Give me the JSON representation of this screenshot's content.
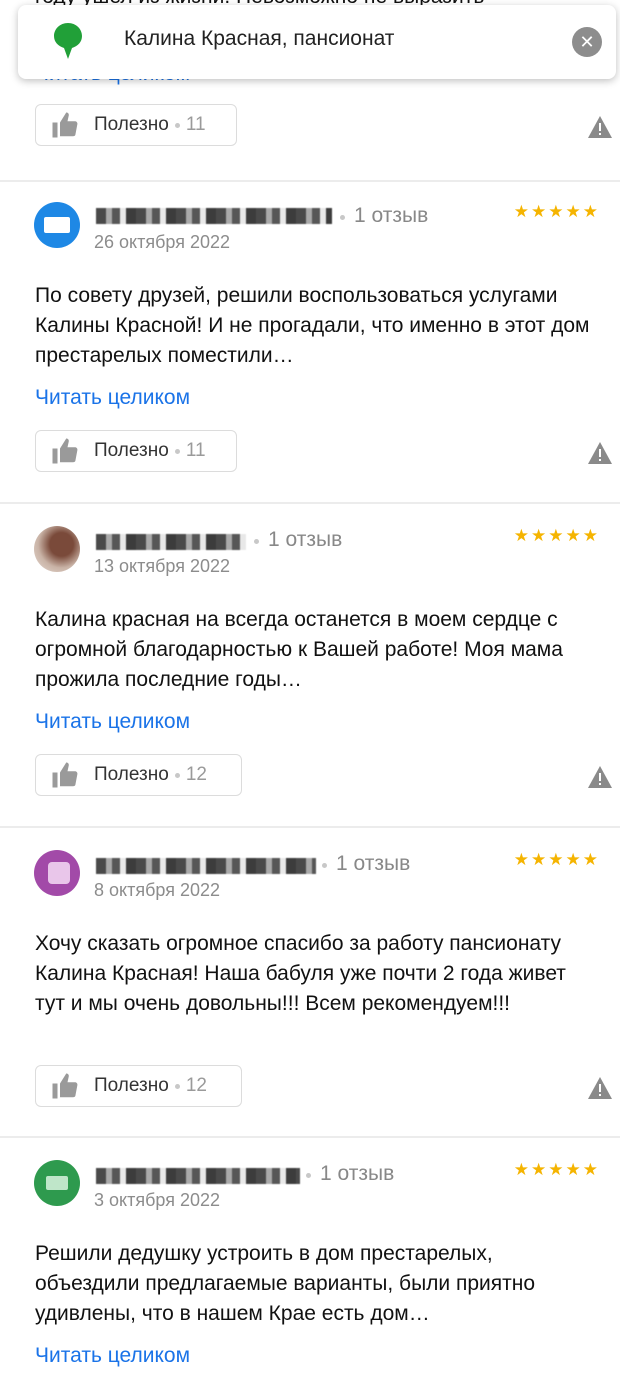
{
  "search": {
    "query": "Калина Красная, пансионат",
    "clear_symbol": "✕"
  },
  "partial": {
    "text": "году ушел из жизни. Невозможно не выразить",
    "read_more": "Читать целиком",
    "helpful_label": "Полезно",
    "helpful_count": "11"
  },
  "reviews": [
    {
      "count_label": "1 отзыв",
      "date": "26 октября 2022",
      "stars": "★★★★★",
      "text": "По совету друзей, решили воспользоваться услугами Калины Красной! И не прогадали, что именно в этот дом престарелых поместили…",
      "read_more": "Читать целиком",
      "helpful_label": "Полезно",
      "helpful_count": "11"
    },
    {
      "count_label": "1 отзыв",
      "date": "13 октября 2022",
      "stars": "★★★★★",
      "text": "Калина красная на всегда останется в моем сердце с огромной благодарностью к Вашей работе! Моя мама прожила последние годы…",
      "read_more": "Читать целиком",
      "helpful_label": "Полезно",
      "helpful_count": "12"
    },
    {
      "count_label": "1 отзыв",
      "date": "8 октября 2022",
      "stars": "★★★★★",
      "text": "Хочу сказать огромное спасибо за работу пансионату Калина Красная! Наша бабуля уже почти 2 года живет тут и мы очень довольны!!! Всем рекомендуем!!!",
      "read_more": "",
      "helpful_label": "Полезно",
      "helpful_count": "12"
    },
    {
      "count_label": "1 отзыв",
      "date": "3 октября 2022",
      "stars": "★★★★★",
      "text": "Решили дедушку устроить в дом престарелых, объездили предлагаемые варианты, были приятно удивлены, что в нашем Крае есть дом…",
      "read_more": "Читать целиком"
    }
  ],
  "colors": {
    "link": "#1a73e8",
    "star": "#f5b400",
    "pin": "#21a038"
  },
  "icons": [
    "map-pin-icon",
    "close-icon",
    "thumbs-up-icon",
    "warning-icon",
    "star-icon"
  ]
}
